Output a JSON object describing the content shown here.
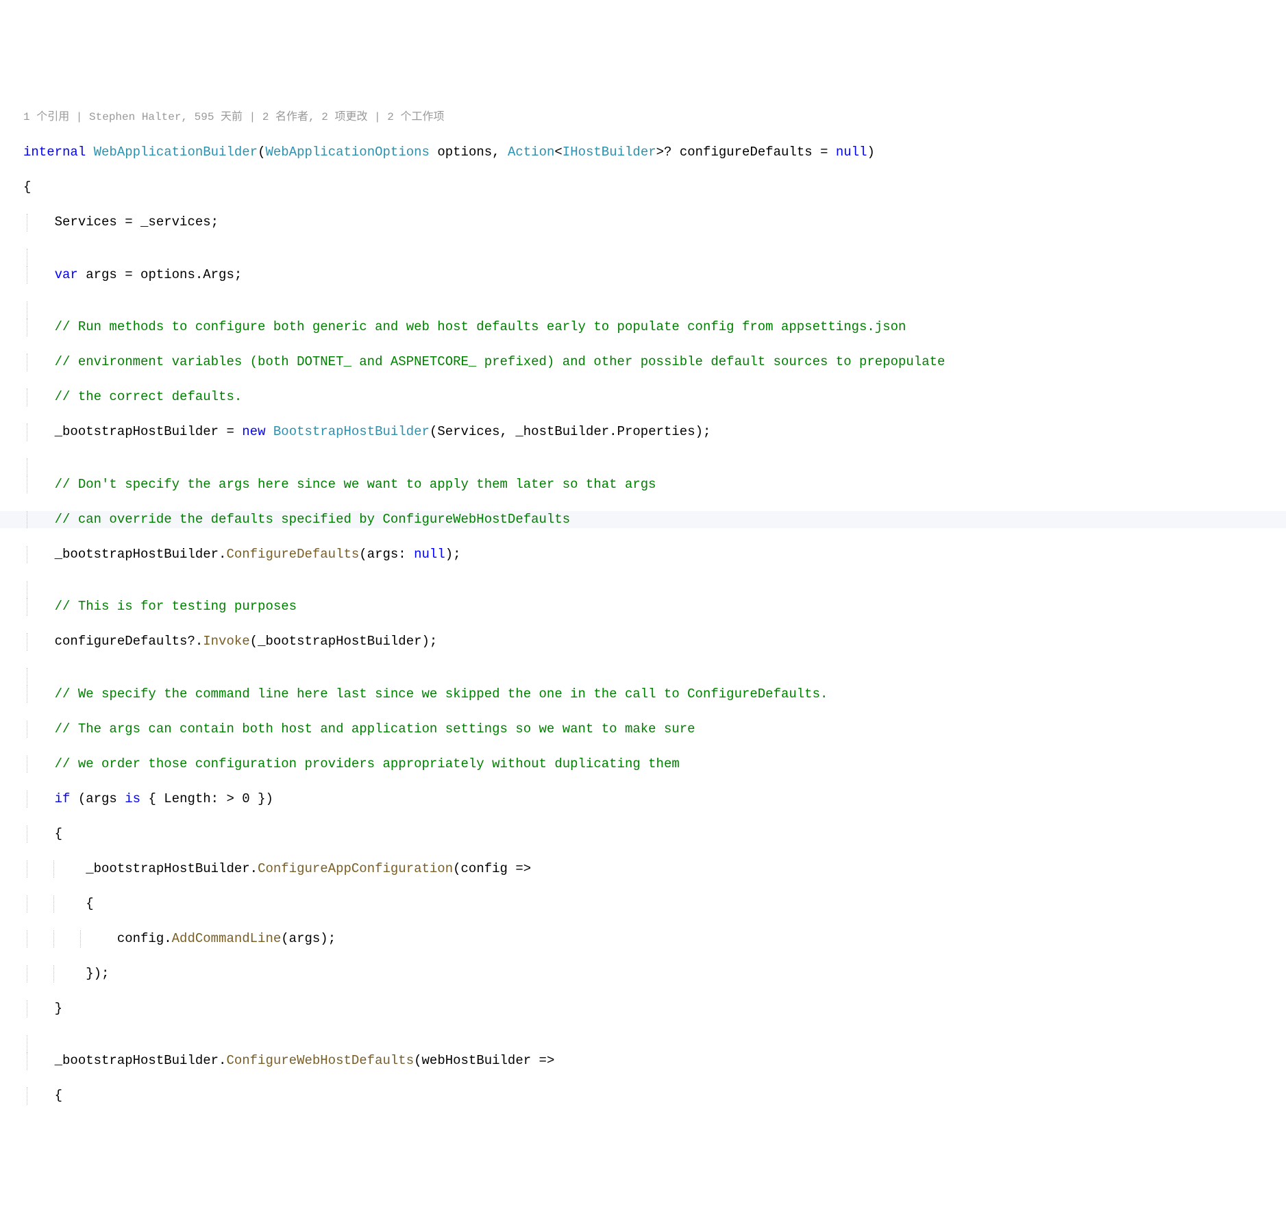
{
  "blame": {
    "partial_text": "1 个引用 | Stephen Halter, 595 天前 | 2 名作者, 2 项更改 | 2 个工作项"
  },
  "code": {
    "l0": {
      "internal": "internal",
      "wab": "WebApplicationBuilder",
      "lparen": "(",
      "wao": "WebApplicationOptions",
      "options": " options, ",
      "action": "Action",
      "lt": "<",
      "ihb": "IHostBuilder",
      "gt": ">? configureDefaults = ",
      "nul": "null",
      "rparen": ")"
    },
    "l1": "{",
    "l2": {
      "services": "    Services = _services;"
    },
    "l3": "",
    "l4": {
      "var": "var",
      "rest": " args = options.Args;"
    },
    "l5": "",
    "l6": "    // Run methods to configure both generic and web host defaults early to populate config from appsettings.json",
    "l7": "    // environment variables (both DOTNET_ and ASPNETCORE_ prefixed) and other possible default sources to prepopulate",
    "l8": "    // the correct defaults.",
    "l9": {
      "pre": "    _bootstrapHostBuilder = ",
      "new": "new",
      "sp": " ",
      "bhb": "BootstrapHostBuilder",
      "args": "(Services, _hostBuilder.Properties);"
    },
    "l10": "",
    "l11": "    // Don't specify the args here since we want to apply them later so that args",
    "l12": "    // can override the defaults specified by ConfigureWebHostDefaults",
    "l13": {
      "pre": "    _bootstrapHostBuilder.",
      "method": "ConfigureDefaults",
      "lparen": "(args: ",
      "nul": "null",
      "rparen": ");"
    },
    "l14": "",
    "l15": "    // This is for testing purposes",
    "l16": {
      "pre": "    configureDefaults?.",
      "invoke": "Invoke",
      "args": "(_bootstrapHostBuilder);"
    },
    "l17": "",
    "l18": "    // We specify the command line here last since we skipped the one in the call to ConfigureDefaults.",
    "l19": "    // The args can contain both host and application settings so we want to make sure",
    "l20": "    // we order those configuration providers appropriately without duplicating them",
    "l21": {
      "if": "if",
      "rest": " (args ",
      "is": "is",
      "rest2": " { Length: > 0 })"
    },
    "l22": "    {",
    "l23": {
      "pre": "        _bootstrapHostBuilder.",
      "method": "ConfigureAppConfiguration",
      "args": "(config =>"
    },
    "l24": "        {",
    "l25": {
      "pre": "            config.",
      "method": "AddCommandLine",
      "args": "(args);"
    },
    "l26": "        });",
    "l27": "    }",
    "l28": "",
    "l29": {
      "pre": "    _bootstrapHostBuilder.",
      "method": "ConfigureWebHostDefaults",
      "args": "(webHostBuilder =>"
    },
    "l30": "    {"
  }
}
